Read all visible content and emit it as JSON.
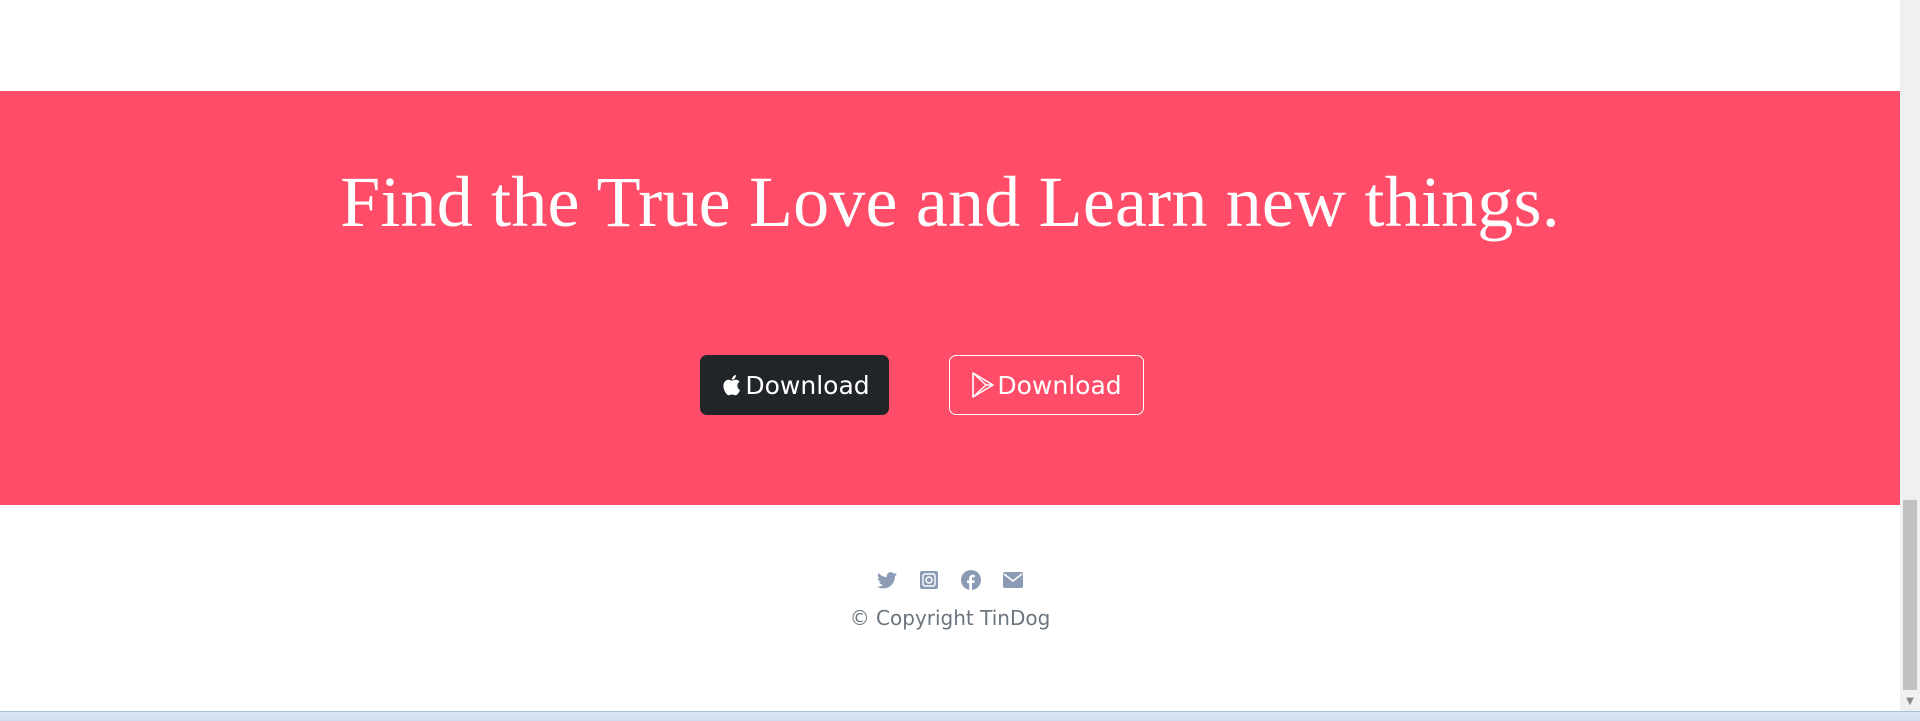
{
  "cta": {
    "heading": "Find the True Love and Learn new things.",
    "buttons": [
      {
        "label": "Download",
        "icon": "apple-icon",
        "style": "dark"
      },
      {
        "label": "Download",
        "icon": "google-play-icon",
        "style": "outline"
      }
    ],
    "background_color": "#ff4c68"
  },
  "footer": {
    "social_icons": [
      "twitter-icon",
      "instagram-icon",
      "facebook-icon",
      "envelope-icon"
    ],
    "icon_color": "#8c9bb5",
    "copyright": "© Copyright TinDog"
  }
}
